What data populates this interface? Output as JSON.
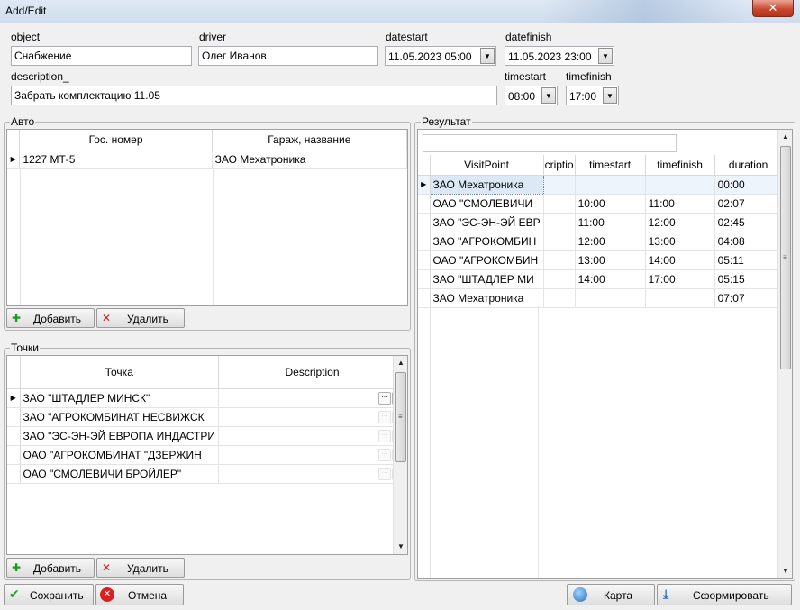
{
  "window": {
    "title": "Add/Edit",
    "close_glyph": "✕"
  },
  "fields": {
    "object": {
      "label": "object",
      "value": "Снабжение"
    },
    "driver": {
      "label": "driver",
      "value": "Олег Иванов"
    },
    "datestart": {
      "label": "datestart",
      "value": "11.05.2023 05:00"
    },
    "datefinish": {
      "label": "datefinish",
      "value": "11.05.2023 23:00"
    },
    "description": {
      "label": "description_",
      "value": "Забрать комплектацию 11.05"
    },
    "timestart": {
      "label": "timestart",
      "value": "08:00"
    },
    "timefinish": {
      "label": "timefinish",
      "value": "17:00"
    }
  },
  "auto": {
    "title": "Авто",
    "columns": [
      "Гос. номер",
      "Гараж, название"
    ],
    "rows": [
      {
        "number": "1227 МТ-5",
        "garage": "ЗАО Мехатроника"
      }
    ],
    "add_label": "Добавить",
    "delete_label": "Удалить"
  },
  "points": {
    "title": "Точки",
    "columns": [
      "Точка",
      "Description"
    ],
    "rows": [
      {
        "point": "ЗАО  \"ШТАДЛЕР МИНСК\"",
        "description": ""
      },
      {
        "point": "ЗАО  \"АГРОКОМБИНАТ НЕСВИЖСК",
        "description": ""
      },
      {
        "point": "ЗАО \"ЭС-ЭН-ЭЙ ЕВРОПА ИНДАСТРИ",
        "description": ""
      },
      {
        "point": "ОАО  \"АГРОКОМБИНАТ \"ДЗЕРЖИН",
        "description": ""
      },
      {
        "point": "ОАО  \"СМОЛЕВИЧИ БРОЙЛЕР\"",
        "description": ""
      }
    ],
    "add_label": "Добавить",
    "delete_label": "Удалить"
  },
  "result": {
    "title": "Результат",
    "filter_value": "",
    "columns": [
      "VisitPoint",
      "criptio",
      "timestart",
      "timefinish",
      "duration"
    ],
    "rows": [
      {
        "visit": "ЗАО Мехатроника",
        "desc": "",
        "start": "",
        "finish": "",
        "duration": "00:00"
      },
      {
        "visit": "ОАО  \"СМОЛЕВИЧИ",
        "desc": "",
        "start": "10:00",
        "finish": "11:00",
        "duration": "02:07"
      },
      {
        "visit": "ЗАО \"ЭС-ЭН-ЭЙ ЕВР",
        "desc": "",
        "start": "11:00",
        "finish": "12:00",
        "duration": "02:45"
      },
      {
        "visit": "ЗАО  \"АГРОКОМБИН",
        "desc": "",
        "start": "12:00",
        "finish": "13:00",
        "duration": "04:08"
      },
      {
        "visit": "ОАО  \"АГРОКОМБИН",
        "desc": "",
        "start": "13:00",
        "finish": "14:00",
        "duration": "05:11"
      },
      {
        "visit": "ЗАО  \"ШТАДЛЕР МИ",
        "desc": "",
        "start": "14:00",
        "finish": "17:00",
        "duration": "05:15"
      },
      {
        "visit": "ЗАО Мехатроника",
        "desc": "",
        "start": "",
        "finish": "",
        "duration": "07:07"
      }
    ]
  },
  "footer": {
    "save_label": "Сохранить",
    "cancel_label": "Отмена",
    "map_label": "Карта",
    "build_label": "Сформировать"
  },
  "icons": {
    "add": "plus-icon",
    "delete": "red-x-icon",
    "save": "green-check-icon",
    "cancel": "red-circle-x-icon",
    "map": "globe-icon",
    "build": "tray-down-icon"
  },
  "colors": {
    "add_green": "#1f9a1f",
    "delete_red": "#d01c1c",
    "selection": "#dce8f5"
  }
}
